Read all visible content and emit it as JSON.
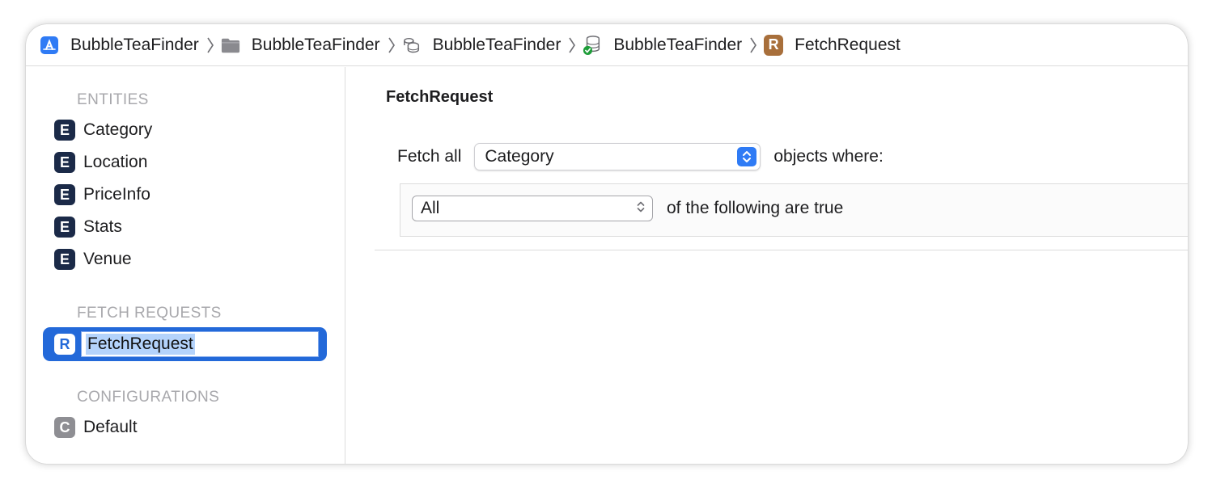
{
  "breadcrumb": [
    {
      "label": "BubbleTeaFinder",
      "icon": "app-icon"
    },
    {
      "label": "BubbleTeaFinder",
      "icon": "folder-icon"
    },
    {
      "label": "BubbleTeaFinder",
      "icon": "data-model-icon"
    },
    {
      "label": "BubbleTeaFinder",
      "icon": "database-check-icon"
    },
    {
      "label": "FetchRequest",
      "icon": "fetch-request-icon",
      "badge": "R"
    }
  ],
  "sidebar": {
    "entities_title": "ENTITIES",
    "entities": [
      {
        "badge": "E",
        "label": "Category"
      },
      {
        "badge": "E",
        "label": "Location"
      },
      {
        "badge": "E",
        "label": "PriceInfo"
      },
      {
        "badge": "E",
        "label": "Stats"
      },
      {
        "badge": "E",
        "label": "Venue"
      }
    ],
    "fetch_requests_title": "FETCH REQUESTS",
    "fetch_requests": [
      {
        "badge": "R",
        "label": "FetchRequest"
      }
    ],
    "configurations_title": "CONFIGURATIONS",
    "configurations": [
      {
        "badge": "C",
        "label": "Default"
      }
    ]
  },
  "main": {
    "title": "FetchRequest",
    "fetch_prefix": "Fetch all",
    "entity_selected": "Category",
    "fetch_suffix": "objects where:",
    "match_selected": "All",
    "match_suffix": "of the following are true"
  },
  "colors": {
    "selection": "#2369d9",
    "entity_badge": "#1b2a48",
    "fetch_badge": "#a86f3b",
    "config_badge": "#8e8e93",
    "popup_accent": "#2f7bf5"
  }
}
